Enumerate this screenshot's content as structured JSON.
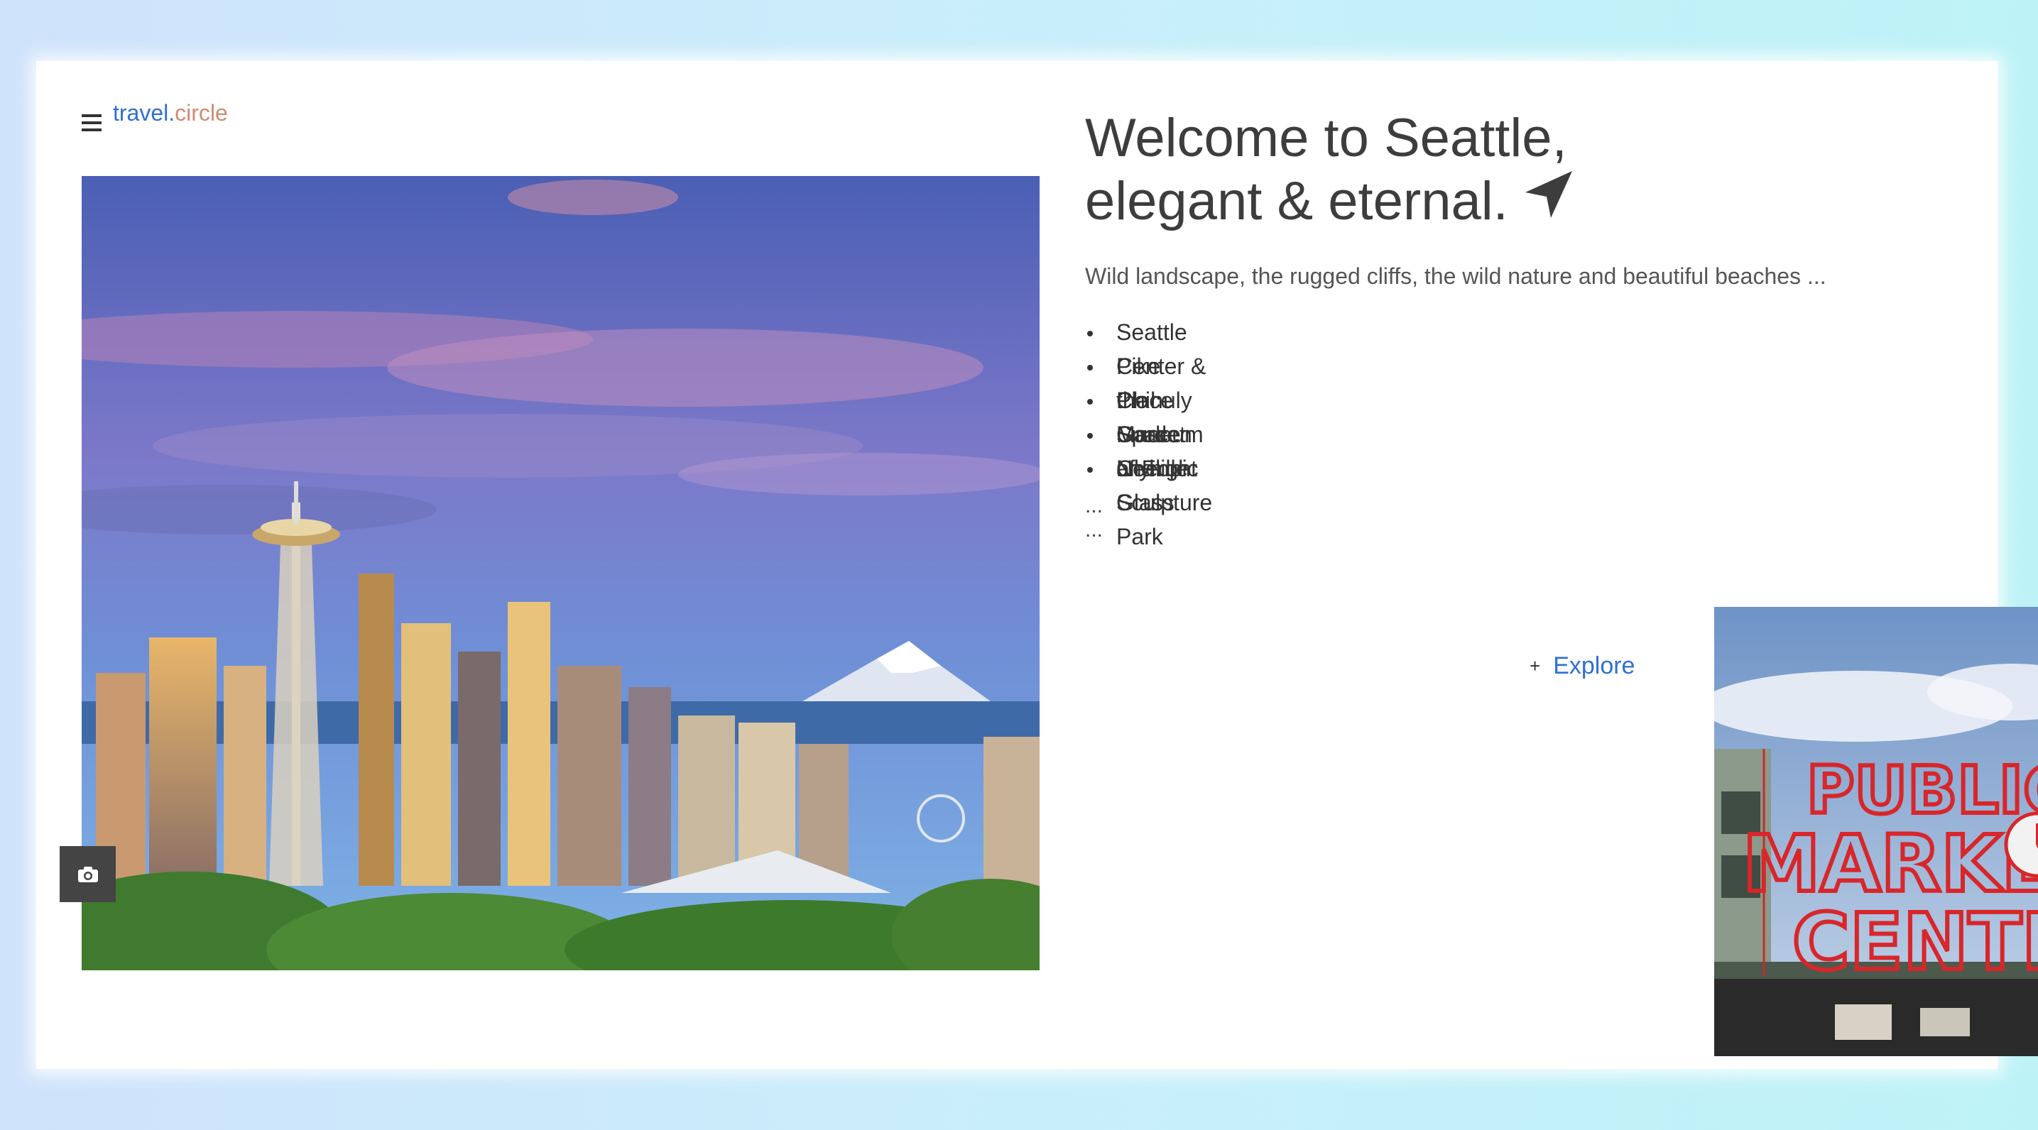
{
  "brand": {
    "part1": "travel.",
    "part2": "circle"
  },
  "header": {
    "title_line1": "Welcome to Seattle,",
    "title_line2": "elegant & eternal.",
    "title_icon": "paper-plane-icon"
  },
  "intro": {
    "subtitle": "Wild landscape, the rugged cliffs, the wild nature and beautiful beaches ..."
  },
  "places": [
    "Seattle Center & the Space Needle",
    "Pike Place Market",
    "Chihuly Garden and Glass",
    "Museum of Flight",
    "Olympic Sculpture Park"
  ],
  "more": "... ...",
  "explore": {
    "icon": "+",
    "label": "Explore"
  },
  "icons": {
    "menu": "hamburger-icon",
    "camera": "camera-icon"
  },
  "sign": {
    "line1": "PUBLIC",
    "line2": "MARKET",
    "line3": "CENTER"
  },
  "colors": {
    "accent_blue": "#2f6fd6",
    "brand_orange": "#d08b70",
    "sign_red": "#d8262a"
  }
}
